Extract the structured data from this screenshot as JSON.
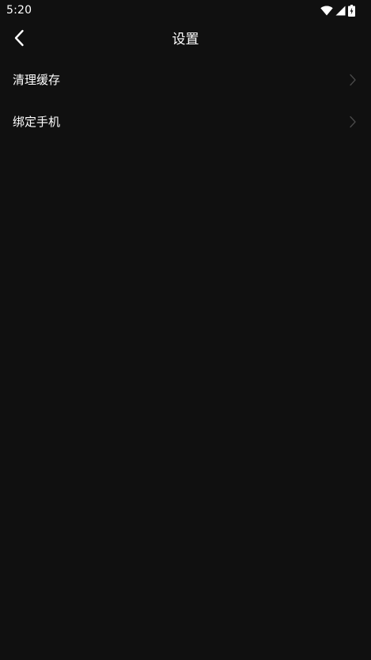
{
  "status_bar": {
    "time": "5:20",
    "icons": [
      "wifi-icon",
      "cellular-signal-icon",
      "battery-charging-icon"
    ]
  },
  "toolbar": {
    "back_icon": "chevron-left-icon",
    "title": "设置"
  },
  "settings": {
    "items": [
      {
        "label": "清理缓存",
        "icon": "chevron-right-icon"
      },
      {
        "label": "绑定手机",
        "icon": "chevron-right-icon"
      }
    ]
  },
  "colors": {
    "background": "#101010",
    "text": "#ffffff",
    "chevron": "#4a4a4a"
  }
}
